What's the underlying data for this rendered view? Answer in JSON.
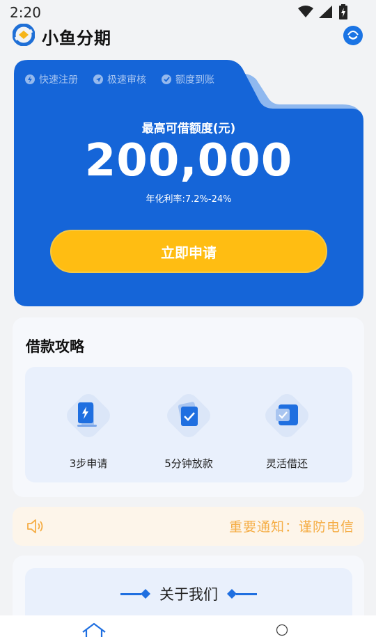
{
  "status_bar": {
    "time": "2:20"
  },
  "app": {
    "title": "小鱼分期"
  },
  "hero": {
    "feature_tags": [
      "快速注册",
      "极速审核",
      "额度到账"
    ],
    "label": "最高可借额度(元)",
    "amount": "200,000",
    "rate": "年化利率:7.2%-24%",
    "apply_label": "立即申请"
  },
  "guide": {
    "title": "借款攻略",
    "steps": [
      {
        "label": "3步申请",
        "icon": "lightning-doc-icon"
      },
      {
        "label": "5分钟放款",
        "icon": "check-doc-icon"
      },
      {
        "label": "灵活借还",
        "icon": "card-check-icon"
      }
    ]
  },
  "notice": {
    "icon": "speaker-icon",
    "text": "重要通知：谨防电信"
  },
  "about": {
    "title": "关于我们"
  },
  "colors": {
    "brand": "#1565d8",
    "accent": "#ffbd12",
    "notice": "#f5ad45"
  }
}
